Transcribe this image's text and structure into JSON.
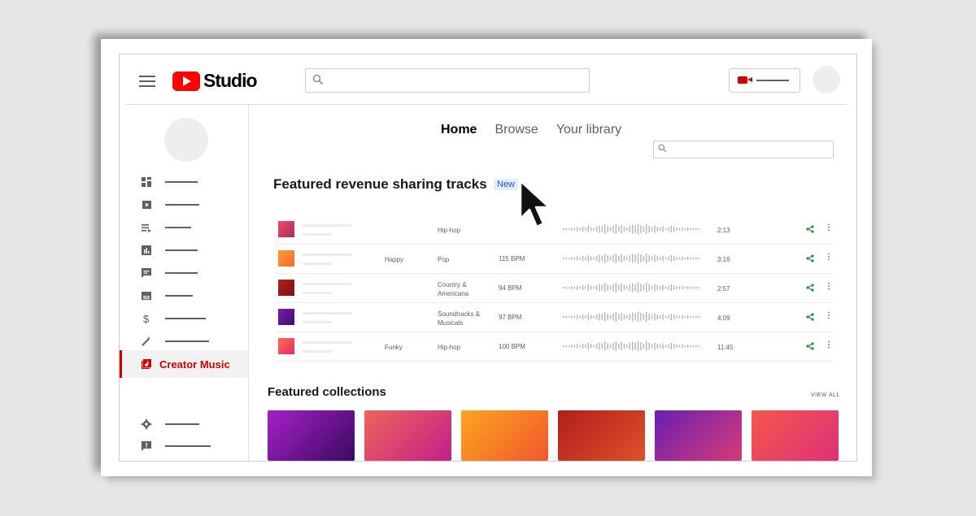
{
  "header": {
    "logo_text": "Studio",
    "search_placeholder": "",
    "icons": [
      "menu-icon",
      "search-icon",
      "create-video-icon"
    ]
  },
  "sidebar": {
    "active_item": {
      "label": "Creator Music",
      "icon": "creator-music-icon",
      "color": "#cc0000"
    },
    "item_icons": [
      "dashboard-icon",
      "content-icon",
      "playlists-icon",
      "analytics-icon",
      "comments-icon",
      "subtitles-icon",
      "earn-icon",
      "customization-icon"
    ],
    "bottom_icons": [
      "settings-icon",
      "feedback-icon"
    ]
  },
  "tabs": [
    {
      "label": "Home",
      "active": true
    },
    {
      "label": "Browse",
      "active": false
    },
    {
      "label": "Your library",
      "active": false
    }
  ],
  "featured": {
    "title": "Featured revenue sharing tracks",
    "badge": "New"
  },
  "tracks": [
    {
      "mood": "",
      "genre": "Hip-hop",
      "bpm": "",
      "duration": "2:13",
      "color_a": "#e94e6e",
      "color_b": "#b02a55"
    },
    {
      "mood": "Happy",
      "genre": "Pop",
      "bpm": "115 BPM",
      "duration": "3:16",
      "color_a": "#ff9a3c",
      "color_b": "#f06b2a"
    },
    {
      "mood": "",
      "genre": "Country & Americana",
      "bpm": "94 BPM",
      "duration": "2:57",
      "color_a": "#b5231d",
      "color_b": "#7a1010"
    },
    {
      "mood": "",
      "genre": "Soundtracks & Musicals",
      "bpm": "97 BPM",
      "duration": "4:09",
      "color_a": "#7a1fa8",
      "color_b": "#3d0f6b"
    },
    {
      "mood": "Funky",
      "genre": "Hip-hop",
      "bpm": "100 BPM",
      "duration": "11:45",
      "color_a": "#ff6b4a",
      "color_b": "#e0306a"
    }
  ],
  "collections": {
    "title": "Featured collections",
    "view_all": "VIEW ALL",
    "items": [
      {
        "color_a": "#a61fc9",
        "color_b": "#3a0a5e"
      },
      {
        "color_a": "#f0645a",
        "color_b": "#c21f8a"
      },
      {
        "color_a": "#fba620",
        "color_b": "#f2572d"
      },
      {
        "color_a": "#b0201a",
        "color_b": "#e0502a"
      },
      {
        "color_a": "#6a1fb0",
        "color_b": "#d63a7a"
      },
      {
        "color_a": "#f5564a",
        "color_b": "#e0307a"
      }
    ]
  }
}
